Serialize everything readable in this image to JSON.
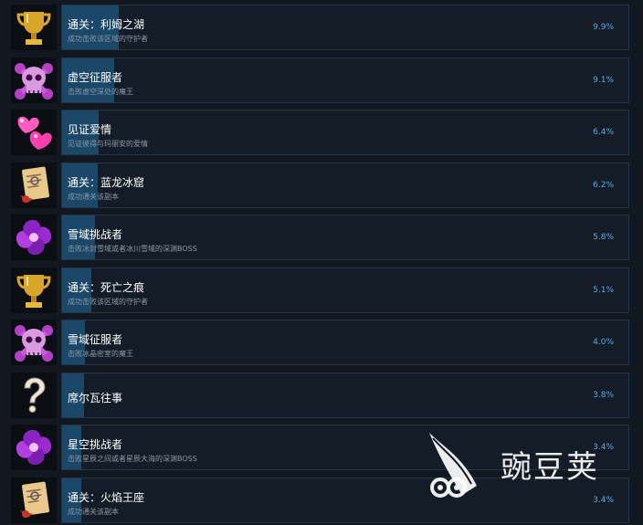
{
  "achievements": [
    {
      "icon": "golden-trophy-icon",
      "title": "通关：利姆之湖",
      "desc": "成功击败该区域的守护者",
      "percent": "9.9%",
      "percent_value": 9.9
    },
    {
      "icon": "purple-skull-icon",
      "title": "虚空征服者",
      "desc": "击败虚空深处的魔王",
      "percent": "9.1%",
      "percent_value": 9.1
    },
    {
      "icon": "hearts-icon",
      "title": "见证爱情",
      "desc": "见证彼得与玛丽安的爱情",
      "percent": "6.4%",
      "percent_value": 6.4
    },
    {
      "icon": "scroll-icon",
      "title": "通关：蓝龙冰窟",
      "desc": "成功通关该副本",
      "percent": "6.2%",
      "percent_value": 6.2
    },
    {
      "icon": "purple-vortex-icon",
      "title": "雪域挑战者",
      "desc": "击败冰封雪域或者冰川雪域的深渊BOSS",
      "percent": "5.8%",
      "percent_value": 5.8
    },
    {
      "icon": "golden-trophy-icon",
      "title": "通关：死亡之痕",
      "desc": "成功击败该区域的守护者",
      "percent": "5.1%",
      "percent_value": 5.1
    },
    {
      "icon": "purple-skull-icon",
      "title": "雪域征服者",
      "desc": "击败冰晶密室的魔王",
      "percent": "4.0%",
      "percent_value": 4.0
    },
    {
      "icon": "question-mark-icon",
      "title": "席尔瓦往事",
      "desc": "",
      "percent": "3.8%",
      "percent_value": 3.8
    },
    {
      "icon": "purple-vortex-icon",
      "title": "星空挑战者",
      "desc": "击败星辰之间或者星辰大海的深渊BOSS",
      "percent": "3.4%",
      "percent_value": 3.4
    },
    {
      "icon": "scroll-icon",
      "title": "通关：火焰王座",
      "desc": "成功通关该副本",
      "percent": "3.4%",
      "percent_value": 3.4
    }
  ],
  "watermark": {
    "text": "豌豆荚"
  },
  "colors": {
    "background": "#121820",
    "card_background": "#141d27",
    "progress_fill": "#1b4868",
    "percent_text": "#5ea8e2",
    "title_text": "#ffffff",
    "desc_text": "#8b98a5"
  }
}
